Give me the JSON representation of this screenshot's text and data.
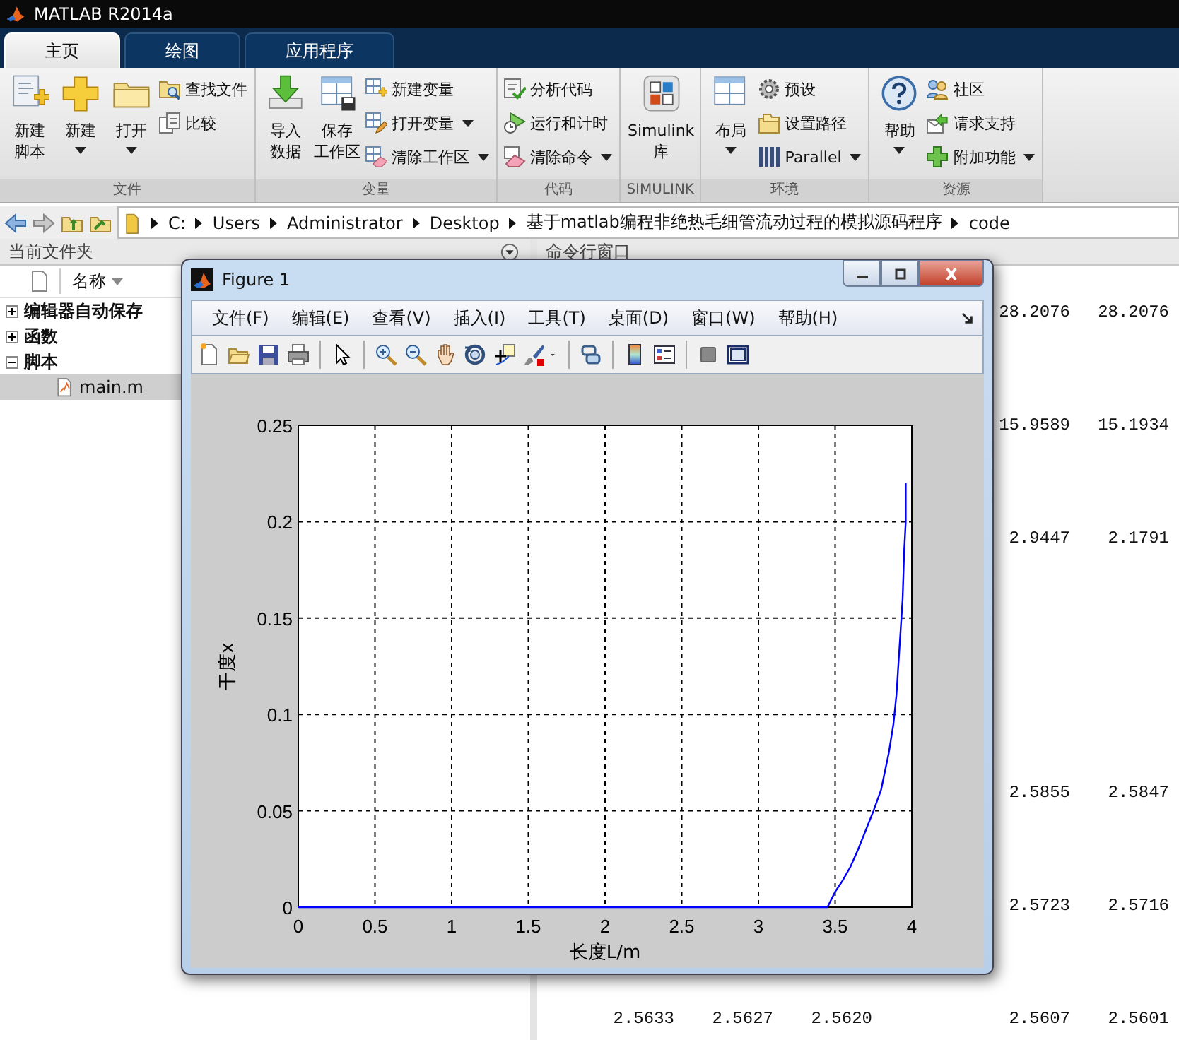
{
  "app": {
    "title": "MATLAB R2014a"
  },
  "tabs": [
    {
      "label": "主页",
      "selected": true
    },
    {
      "label": "绘图",
      "selected": false
    },
    {
      "label": "应用程序",
      "selected": false
    }
  ],
  "ribbon": {
    "groups": [
      {
        "label": "文件",
        "large": [
          {
            "lines": [
              "新建",
              "脚本"
            ],
            "dropdown": false
          },
          {
            "lines": [
              "新建"
            ],
            "dropdown": true
          },
          {
            "lines": [
              "打开"
            ],
            "dropdown": true
          }
        ],
        "small": [
          {
            "label": "查找文件",
            "dropdown": false
          },
          {
            "label": "比较",
            "dropdown": false
          }
        ]
      },
      {
        "label": "变量",
        "large": [
          {
            "lines": [
              "导入",
              "数据"
            ],
            "dropdown": false
          },
          {
            "lines": [
              "保存",
              "工作区"
            ],
            "dropdown": false
          }
        ],
        "small": [
          {
            "label": "新建变量",
            "dropdown": false
          },
          {
            "label": "打开变量",
            "dropdown": true
          },
          {
            "label": "清除工作区",
            "dropdown": true
          }
        ]
      },
      {
        "label": "代码",
        "small": [
          {
            "label": "分析代码",
            "dropdown": false
          },
          {
            "label": "运行和计时",
            "dropdown": false
          },
          {
            "label": "清除命令",
            "dropdown": true
          }
        ]
      },
      {
        "label": "SIMULINK",
        "large": [
          {
            "lines": [
              "Simulink",
              "库"
            ],
            "dropdown": false
          }
        ]
      },
      {
        "label": "环境",
        "large": [
          {
            "lines": [
              "布局"
            ],
            "dropdown": true
          }
        ],
        "small": [
          {
            "label": "预设",
            "dropdown": false
          },
          {
            "label": "设置路径",
            "dropdown": false
          },
          {
            "label": "Parallel",
            "dropdown": true
          }
        ]
      },
      {
        "label": "资源",
        "large": [
          {
            "lines": [
              "帮助"
            ],
            "dropdown": true
          }
        ],
        "small": [
          {
            "label": "社区",
            "dropdown": false
          },
          {
            "label": "请求支持",
            "dropdown": false
          },
          {
            "label": "附加功能",
            "dropdown": true
          }
        ]
      }
    ]
  },
  "address_bar": {
    "path": [
      "C:",
      "Users",
      "Administrator",
      "Desktop",
      "基于matlab编程非绝热毛细管流动过程的模拟源码程序",
      "code"
    ]
  },
  "current_folder": {
    "title": "当前文件夹",
    "column": "名称",
    "items": [
      {
        "label": "编辑器自动保存",
        "expanded": false,
        "selected": false
      },
      {
        "label": "函数",
        "expanded": false,
        "selected": false
      },
      {
        "label": "脚本",
        "expanded": true,
        "selected": false,
        "children": [
          {
            "label": "main.m",
            "selected": true
          }
        ]
      }
    ]
  },
  "command_window": {
    "title": "命令行窗口",
    "rows": [
      [
        "28.2076",
        "28.2076"
      ],
      [
        "15.9589",
        "15.1934"
      ],
      [
        "2.9447",
        "2.1791"
      ],
      [
        "2.5855",
        "2.5847"
      ],
      [
        "2.5723",
        "2.5716"
      ],
      [
        "2.5633",
        "2.5627",
        "2.5620",
        null,
        "2.5607",
        "2.5601"
      ]
    ]
  },
  "figure": {
    "title": "Figure 1",
    "menu": [
      "文件(F)",
      "编辑(E)",
      "查看(V)",
      "插入(I)",
      "工具(T)",
      "桌面(D)",
      "窗口(W)",
      "帮助(H)"
    ],
    "chart_data": {
      "type": "line",
      "grid": true,
      "xlabel": "长度L/m",
      "ylabel": "干度x",
      "x": [
        0,
        3.45,
        3.5,
        3.55,
        3.6,
        3.65,
        3.7,
        3.75,
        3.8,
        3.85,
        3.88,
        3.9,
        3.92,
        3.94,
        3.95,
        3.96,
        3.96
      ],
      "series": [
        {
          "color": "#0000ff",
          "values": [
            0,
            0,
            0.008,
            0.014,
            0.021,
            0.03,
            0.04,
            0.05,
            0.061,
            0.08,
            0.095,
            0.11,
            0.135,
            0.16,
            0.185,
            0.2,
            0.22
          ]
        }
      ],
      "xlim": [
        0,
        4
      ],
      "ylim": [
        0,
        0.25
      ],
      "xticks": [
        0,
        0.5,
        1,
        1.5,
        2,
        2.5,
        3,
        3.5,
        4
      ],
      "yticks": [
        0,
        0.05,
        0.1,
        0.15,
        0.2,
        0.25
      ]
    }
  }
}
